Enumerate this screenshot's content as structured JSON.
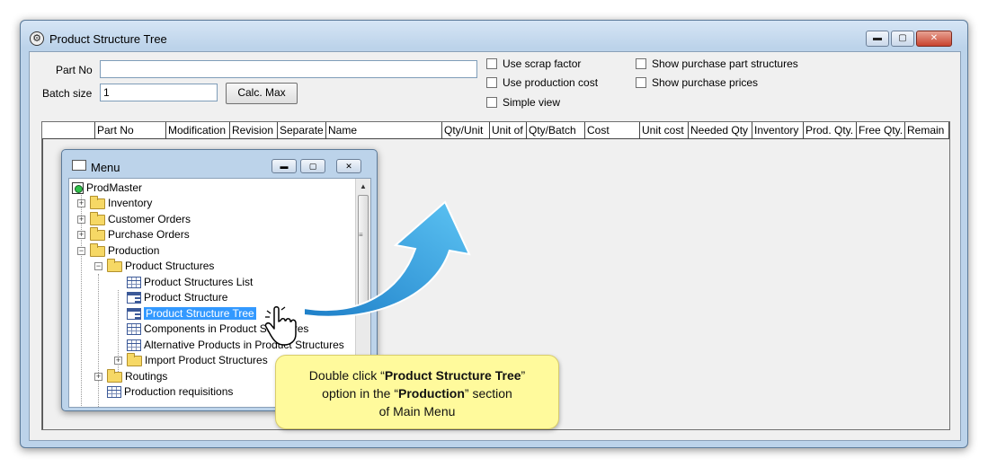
{
  "window": {
    "title": "Product Structure Tree",
    "buttons": {
      "minimize": "▬",
      "maximize": "▢",
      "close": "✕"
    }
  },
  "form": {
    "part_no_label": "Part No",
    "part_no_value": "",
    "batch_size_label": "Batch size",
    "batch_size_value": "1",
    "calc_max_label": "Calc. Max",
    "checkboxes": [
      {
        "label": "Use scrap factor",
        "checked": false
      },
      {
        "label": "Use production cost",
        "checked": false
      },
      {
        "label": "Simple view",
        "checked": false
      },
      {
        "label": "Show purchase part structures",
        "checked": false
      },
      {
        "label": "Show purchase prices",
        "checked": false
      }
    ]
  },
  "grid": {
    "columns": [
      "",
      "Part No",
      "Modification",
      "Revision",
      "Separate",
      "Name",
      "Qty/Unit",
      "Unit of",
      "Qty/Batch",
      "Cost",
      "Unit cost",
      "Needed Qty",
      "Inventory",
      "Prod. Qty.",
      "Free Qty.",
      "Remain"
    ]
  },
  "menu": {
    "title": "Menu",
    "tree": [
      {
        "label": "ProdMaster",
        "type": "root"
      },
      {
        "label": "Inventory",
        "type": "folder",
        "expander": "+"
      },
      {
        "label": "Customer Orders",
        "type": "folder",
        "expander": "+"
      },
      {
        "label": "Purchase Orders",
        "type": "folder",
        "expander": "+"
      },
      {
        "label": "Production",
        "type": "folder-open",
        "expander": "−"
      },
      {
        "label": "Product Structures",
        "type": "folder-open",
        "expander": "−"
      },
      {
        "label": "Product Structures List",
        "type": "grid"
      },
      {
        "label": "Product Structure",
        "type": "tree"
      },
      {
        "label": "Product Structure Tree",
        "type": "tree",
        "selected": true
      },
      {
        "label": "Components in Product Structures",
        "type": "grid"
      },
      {
        "label": "Alternative Products in Product Structures",
        "type": "grid"
      },
      {
        "label": "Import Product Structures",
        "type": "folder",
        "expander": "+"
      },
      {
        "label": "Routings",
        "type": "folder",
        "expander": "+"
      },
      {
        "label": "Production requisitions",
        "type": "grid"
      }
    ]
  },
  "callout": {
    "line1_pre": "Double click “",
    "line1_bold": "Product Structure Tree",
    "line1_post": "”",
    "line2_pre": "option in the “",
    "line2_bold": "Production",
    "line2_post": "”  section",
    "line3": "of Main Menu"
  },
  "colors": {
    "accent_arrow": "#2a9be0",
    "callout_bg": "#fffa9c",
    "selection": "#3399ff"
  }
}
